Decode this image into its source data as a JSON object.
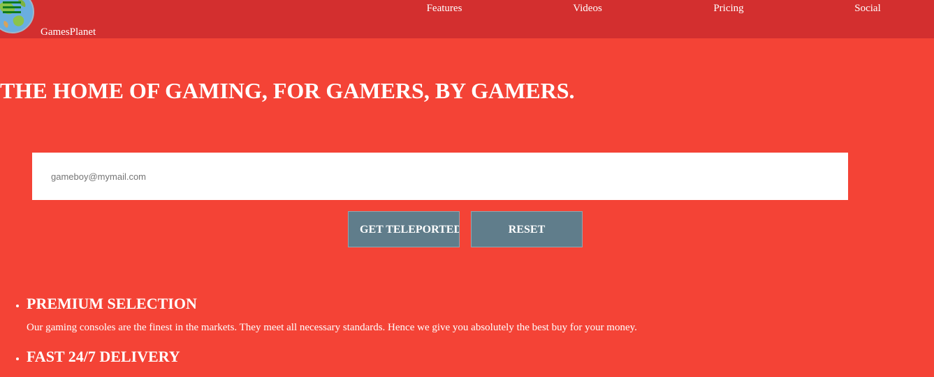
{
  "header": {
    "brand": "GamesPlanet",
    "logo_icon": "globe-icon",
    "menu_icon": "hamburger-icon",
    "nav": [
      {
        "label": "Features"
      },
      {
        "label": "Videos"
      },
      {
        "label": "Pricing"
      },
      {
        "label": "Social"
      }
    ]
  },
  "hero": {
    "headline": "THE HOME OF GAMING, FOR GAMERS, BY GAMERS."
  },
  "form": {
    "email_placeholder": "gameboy@mymail.com",
    "submit_label": "GET TELEPORTED",
    "reset_label": "RESET"
  },
  "features": [
    {
      "title": "PREMIUM SELECTION",
      "description": "Our gaming consoles are the finest in the markets. They meet all necessary standards. Hence we give you absolutely the best buy for your money."
    },
    {
      "title": "FAST 24/7 DELIVERY",
      "description": ""
    }
  ],
  "colors": {
    "page_background": "#f44336",
    "header_background": "#d32f2f",
    "button_background": "#607d8b",
    "text": "#ffffff"
  }
}
